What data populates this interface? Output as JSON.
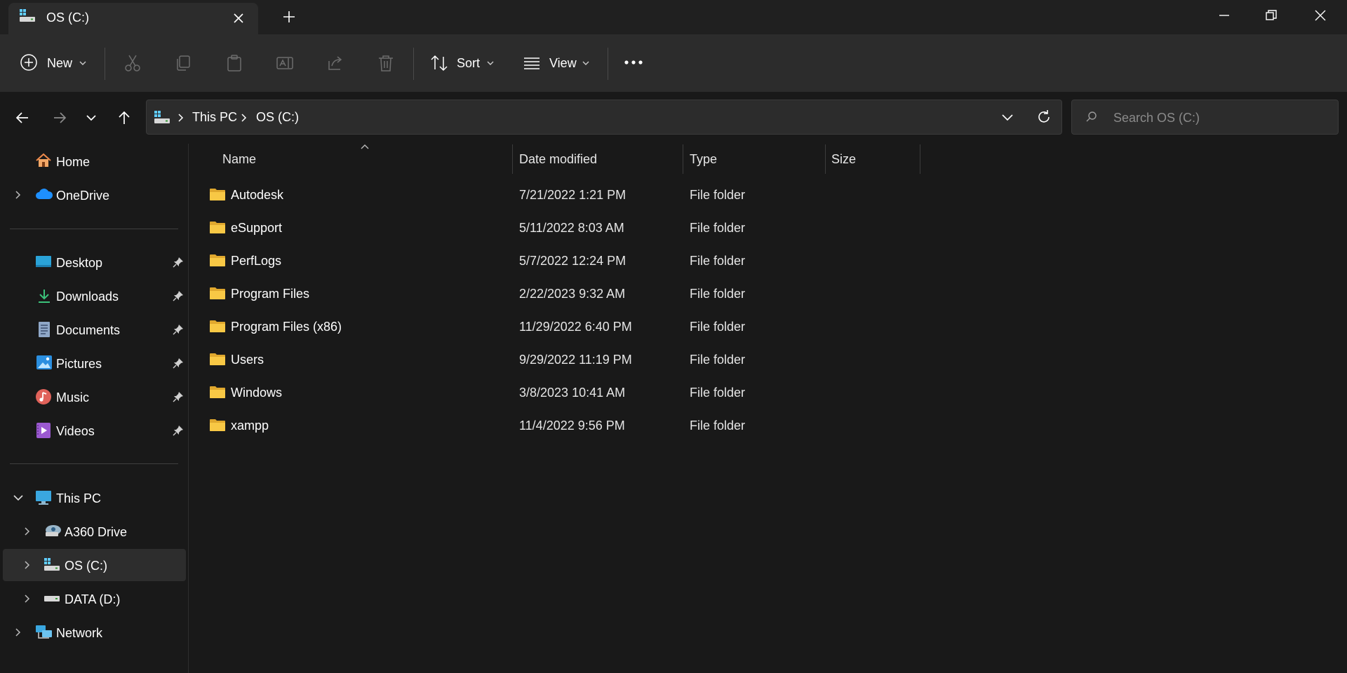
{
  "window": {
    "tab_title": "OS (C:)",
    "new_tab_symbol": "+"
  },
  "toolbar": {
    "new_label": "New",
    "sort_label": "Sort",
    "view_label": "View",
    "more_symbol": "•••"
  },
  "address": {
    "crumbs": [
      "This PC",
      "OS (C:)"
    ],
    "search_placeholder": "Search OS (C:)"
  },
  "sidebar": {
    "quick": [
      {
        "label": "Home"
      },
      {
        "label": "OneDrive"
      }
    ],
    "pinned": [
      {
        "label": "Desktop"
      },
      {
        "label": "Downloads"
      },
      {
        "label": "Documents"
      },
      {
        "label": "Pictures"
      },
      {
        "label": "Music"
      },
      {
        "label": "Videos"
      }
    ],
    "this_pc": {
      "label": "This PC"
    },
    "drives": [
      {
        "label": "A360 Drive"
      },
      {
        "label": "OS (C:)"
      },
      {
        "label": "DATA (D:)"
      }
    ],
    "network": {
      "label": "Network"
    }
  },
  "columns": {
    "name": "Name",
    "date": "Date modified",
    "type": "Type",
    "size": "Size"
  },
  "files": [
    {
      "name": "Autodesk",
      "date": "7/21/2022 1:21 PM",
      "type": "File folder"
    },
    {
      "name": "eSupport",
      "date": "5/11/2022 8:03 AM",
      "type": "File folder"
    },
    {
      "name": "PerfLogs",
      "date": "5/7/2022 12:24 PM",
      "type": "File folder"
    },
    {
      "name": "Program Files",
      "date": "2/22/2023 9:32 AM",
      "type": "File folder"
    },
    {
      "name": "Program Files (x86)",
      "date": "11/29/2022 6:40 PM",
      "type": "File folder"
    },
    {
      "name": "Users",
      "date": "9/29/2022 11:19 PM",
      "type": "File folder"
    },
    {
      "name": "Windows",
      "date": "3/8/2023 10:41 AM",
      "type": "File folder"
    },
    {
      "name": "xampp",
      "date": "11/4/2022 9:56 PM",
      "type": "File folder"
    }
  ],
  "colors": {
    "background": "#191919",
    "chrome": "#2c2c2c",
    "folder": "#f8c845",
    "accent": "#60cdff"
  }
}
